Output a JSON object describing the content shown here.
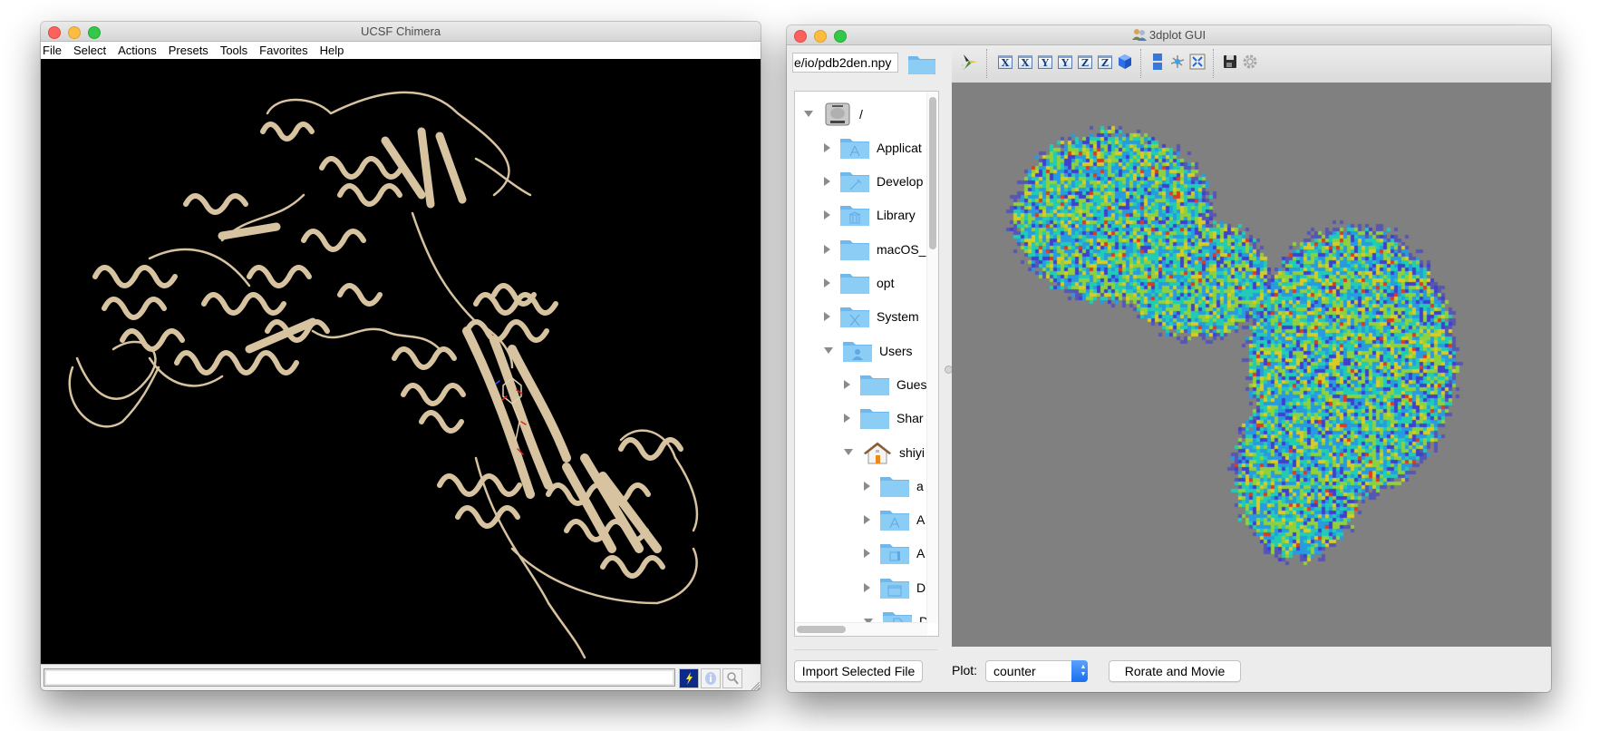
{
  "chimera": {
    "title": "UCSF Chimera",
    "menu": [
      "File",
      "Select",
      "Actions",
      "Presets",
      "Tools",
      "Favorites",
      "Help"
    ],
    "command_line": {
      "value": "",
      "placeholder": ""
    },
    "bottom_buttons": [
      {
        "name": "lightning-icon",
        "label": "Command line"
      },
      {
        "name": "info-icon",
        "label": "Info"
      },
      {
        "name": "magnifier-icon",
        "label": "Search"
      }
    ],
    "viewport": {
      "content": "protein ribbon structure",
      "background": "#000000",
      "ribbon_color": "#d8c3a0"
    }
  },
  "plotgui": {
    "title": "3dplot GUI",
    "path_input": {
      "value": "e/io/pdb2den.npy"
    },
    "toolbar": {
      "groups": [
        [
          "rotate-axes-icon"
        ],
        [
          "view-x-pos-icon",
          "view-x-neg-icon",
          "view-y-pos-icon",
          "view-y-neg-icon",
          "view-z-pos-icon",
          "view-z-neg-icon",
          "view-iso-icon"
        ],
        [
          "layout-split-icon",
          "axes-icon",
          "fit-screen-icon"
        ],
        [
          "save-icon",
          "settings-icon"
        ]
      ],
      "axis_labels": [
        "X",
        "X",
        "Y",
        "Y",
        "Z",
        "Z"
      ]
    },
    "tree": [
      {
        "label": "/",
        "depth": 0,
        "expanded": true,
        "icon": "hard-drive-icon"
      },
      {
        "label": "Applicat",
        "depth": 1,
        "expanded": false,
        "icon": "applications-folder-icon"
      },
      {
        "label": "Develop",
        "depth": 1,
        "expanded": false,
        "icon": "developer-folder-icon"
      },
      {
        "label": "Library",
        "depth": 1,
        "expanded": false,
        "icon": "library-folder-icon"
      },
      {
        "label": "macOS_",
        "depth": 1,
        "expanded": false,
        "icon": "folder-icon"
      },
      {
        "label": "opt",
        "depth": 1,
        "expanded": false,
        "icon": "folder-icon"
      },
      {
        "label": "System",
        "depth": 1,
        "expanded": false,
        "icon": "system-folder-icon"
      },
      {
        "label": "Users",
        "depth": 1,
        "expanded": true,
        "icon": "users-folder-icon"
      },
      {
        "label": "Gues",
        "depth": 2,
        "expanded": false,
        "icon": "folder-icon"
      },
      {
        "label": "Shar",
        "depth": 2,
        "expanded": false,
        "icon": "folder-icon"
      },
      {
        "label": "shiyi",
        "depth": 2,
        "expanded": true,
        "icon": "home-icon"
      },
      {
        "label": "a",
        "depth": 3,
        "expanded": false,
        "icon": "folder-icon"
      },
      {
        "label": "A",
        "depth": 3,
        "expanded": false,
        "icon": "applications-folder-icon"
      },
      {
        "label": "A",
        "depth": 3,
        "expanded": false,
        "icon": "app-support-folder-icon"
      },
      {
        "label": "D",
        "depth": 3,
        "expanded": false,
        "icon": "desktop-folder-icon"
      },
      {
        "label": "D",
        "depth": 3,
        "expanded": true,
        "icon": "documents-folder-icon"
      }
    ],
    "import_button": "Import Selected File",
    "plot_label": "Plot:",
    "plot_select": {
      "value": "counter"
    },
    "movie_button": "Rorate and Movie",
    "plot": {
      "content": "density projection heatmap",
      "background": "#808080",
      "colormap": [
        "#3b3bd6",
        "#1f9de8",
        "#19d2b8",
        "#8fd838",
        "#e0d21c",
        "#e3351c"
      ]
    }
  }
}
